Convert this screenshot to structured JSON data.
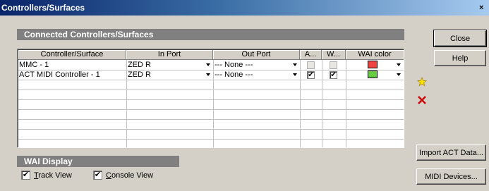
{
  "window": {
    "title": "Controllers/Surfaces",
    "close_glyph": "×"
  },
  "connected": {
    "header": "Connected Controllers/Surfaces",
    "columns": [
      "Controller/Surface",
      "In Port",
      "Out Port",
      "A...",
      "W...",
      "WAI color"
    ],
    "rows": [
      {
        "name": "MMC - 1",
        "in_port": "ZED R",
        "out_port": "--- None ---",
        "active": false,
        "active_enabled": false,
        "wai": false,
        "wai_enabled": false,
        "wai_color": "#ee4444"
      },
      {
        "name": "ACT MIDI Controller - 1",
        "in_port": "ZED R",
        "out_port": "--- None ---",
        "active": true,
        "active_enabled": true,
        "wai": true,
        "wai_enabled": true,
        "wai_color": "#66cc44"
      }
    ]
  },
  "wai_display": {
    "header": "WAI Display",
    "track_view": {
      "label_accel": "T",
      "label_rest": "rack View",
      "checked": true
    },
    "console_view": {
      "label_accel": "C",
      "label_rest": "onsole View",
      "checked": true
    }
  },
  "buttons": {
    "close": "Close",
    "help": "Help",
    "import_act": "Import ACT Data...",
    "midi_devices": "MIDI Devices..."
  },
  "icons": {
    "add": "add-star-icon",
    "delete": "delete-x-icon"
  }
}
